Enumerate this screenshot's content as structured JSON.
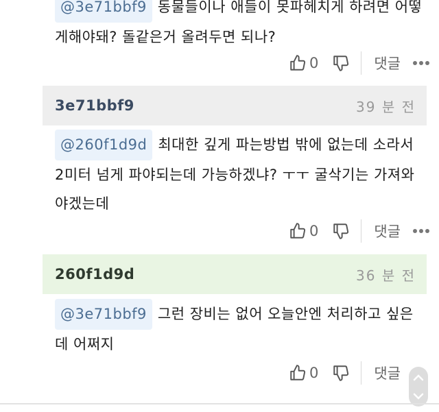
{
  "comments": [
    {
      "mention": "@3e71bbf9",
      "text": "동물들이나 애들이 못파헤치게 하려면 어떻게해야돼? 돌같은거 올려두면 되나?",
      "likes": "0",
      "reply_label": "댓글"
    },
    {
      "user": "3e71bbf9",
      "time": "39 분 전",
      "mention": "@260f1d9d",
      "text": "최대한 깊게 파는방법 밖에 없는데 소라서 2미터 넘게 파야되는데 가능하겠냐? ㅜㅜ 굴삭기는 가져와야겠는데",
      "likes": "0",
      "reply_label": "댓글"
    },
    {
      "user": "260f1d9d",
      "time": "36 분 전",
      "mention": "@3e71bbf9",
      "text": "그런 장비는 없어 오늘안엔 처리하고 싶은데 어쩌지",
      "likes": "0",
      "reply_label": "댓글"
    }
  ],
  "icons": {
    "like": "thumbs-up-icon",
    "dislike": "thumbs-down-icon",
    "more": "more-dots-icon",
    "scroll_up": "chevron-up-icon",
    "scroll_down": "chevron-down-icon"
  },
  "colors": {
    "mention_bg": "#eaf2fb",
    "mention_text": "#4b6d92",
    "header_gray": "#eeeeee",
    "header_green": "#e9f5e3"
  }
}
